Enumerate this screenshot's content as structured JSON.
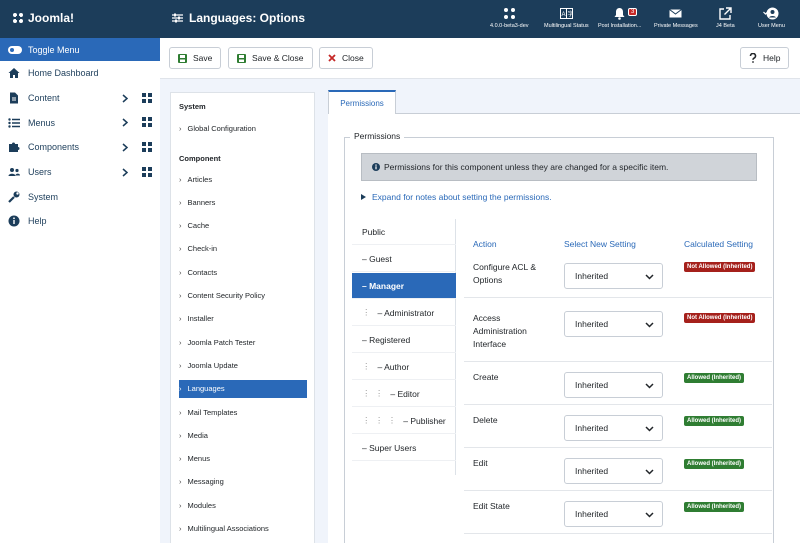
{
  "header": {
    "logo_text": "Joomla!",
    "title": "Languages: Options",
    "items": [
      {
        "icon": "joomla-icon",
        "label": "4.0.0-beta3-dev"
      },
      {
        "icon": "language-icon",
        "label": "Multilingual Status"
      },
      {
        "icon": "bell-icon",
        "label": "Post Installation...",
        "badge": "3"
      },
      {
        "icon": "envelope-icon",
        "label": "Private Messages"
      },
      {
        "icon": "external-link-icon",
        "label": "J4 Beta"
      },
      {
        "icon": "user-icon",
        "label": "User Menu"
      }
    ]
  },
  "sidebar": {
    "toggle_label": "Toggle Menu",
    "items": [
      {
        "label": "Home Dashboard",
        "icon": "home-icon"
      },
      {
        "label": "Content",
        "icon": "file-icon"
      },
      {
        "label": "Menus",
        "icon": "list-icon"
      },
      {
        "label": "Components",
        "icon": "puzzle-icon"
      },
      {
        "label": "Users",
        "icon": "users-icon"
      },
      {
        "label": "System",
        "icon": "wrench-icon"
      },
      {
        "label": "Help",
        "icon": "info-icon"
      }
    ]
  },
  "toolbar": {
    "save": "Save",
    "save_close": "Save & Close",
    "close": "Close",
    "help": "Help"
  },
  "leftpanel": {
    "system_heading": "System",
    "global_config": "Global Configuration",
    "component_heading": "Component",
    "components": [
      "Articles",
      "Banners",
      "Cache",
      "Check-in",
      "Contacts",
      "Content Security Policy",
      "Installer",
      "Joomla Patch Tester",
      "Joomla Update",
      "Languages",
      "Mail Templates",
      "Media",
      "Menus",
      "Messaging",
      "Modules",
      "Multilingual Associations"
    ],
    "active": "Languages"
  },
  "main": {
    "tab": "Permissions",
    "legend": "Permissions",
    "info": "Permissions for this component unless they are changed for a specific item.",
    "expand": "Expand for notes about setting the permissions.",
    "groups": [
      {
        "label": "Public",
        "dots": ""
      },
      {
        "label": "– Guest",
        "dots": ""
      },
      {
        "label": "– Manager",
        "dots": ""
      },
      {
        "label": "– Administrator",
        "dots": "⋮"
      },
      {
        "label": "– Registered",
        "dots": ""
      },
      {
        "label": "– Author",
        "dots": "⋮"
      },
      {
        "label": "– Editor",
        "dots": "⋮ ⋮"
      },
      {
        "label": "– Publisher",
        "dots": "⋮ ⋮ ⋮"
      },
      {
        "label": "– Super Users",
        "dots": ""
      }
    ],
    "active_group": "– Manager",
    "table_headers": {
      "action": "Action",
      "select": "Select New Setting",
      "calc": "Calculated Setting"
    },
    "rows": [
      {
        "action_lines": [
          "Configure ACL &",
          "Options"
        ],
        "select": "Inherited",
        "calc": "Not Allowed (Inherited)",
        "status": "not-allowed"
      },
      {
        "action_lines": [
          "Access",
          "Administration",
          "Interface"
        ],
        "select": "Inherited",
        "calc": "Not Allowed (Inherited)",
        "status": "not-allowed"
      },
      {
        "action_lines": [
          "Create"
        ],
        "select": "Inherited",
        "calc": "Allowed (Inherited)",
        "status": "allowed"
      },
      {
        "action_lines": [
          "Delete"
        ],
        "select": "Inherited",
        "calc": "Allowed (Inherited)",
        "status": "allowed"
      },
      {
        "action_lines": [
          "Edit"
        ],
        "select": "Inherited",
        "calc": "Allowed (Inherited)",
        "status": "allowed"
      },
      {
        "action_lines": [
          "Edit State"
        ],
        "select": "Inherited",
        "calc": "Allowed (Inherited)",
        "status": "allowed"
      }
    ]
  },
  "colors": {
    "header_bg": "#1c3d5a",
    "accent": "#2a69b8",
    "not_allowed": "#a5201b",
    "allowed": "#2f7d32"
  }
}
